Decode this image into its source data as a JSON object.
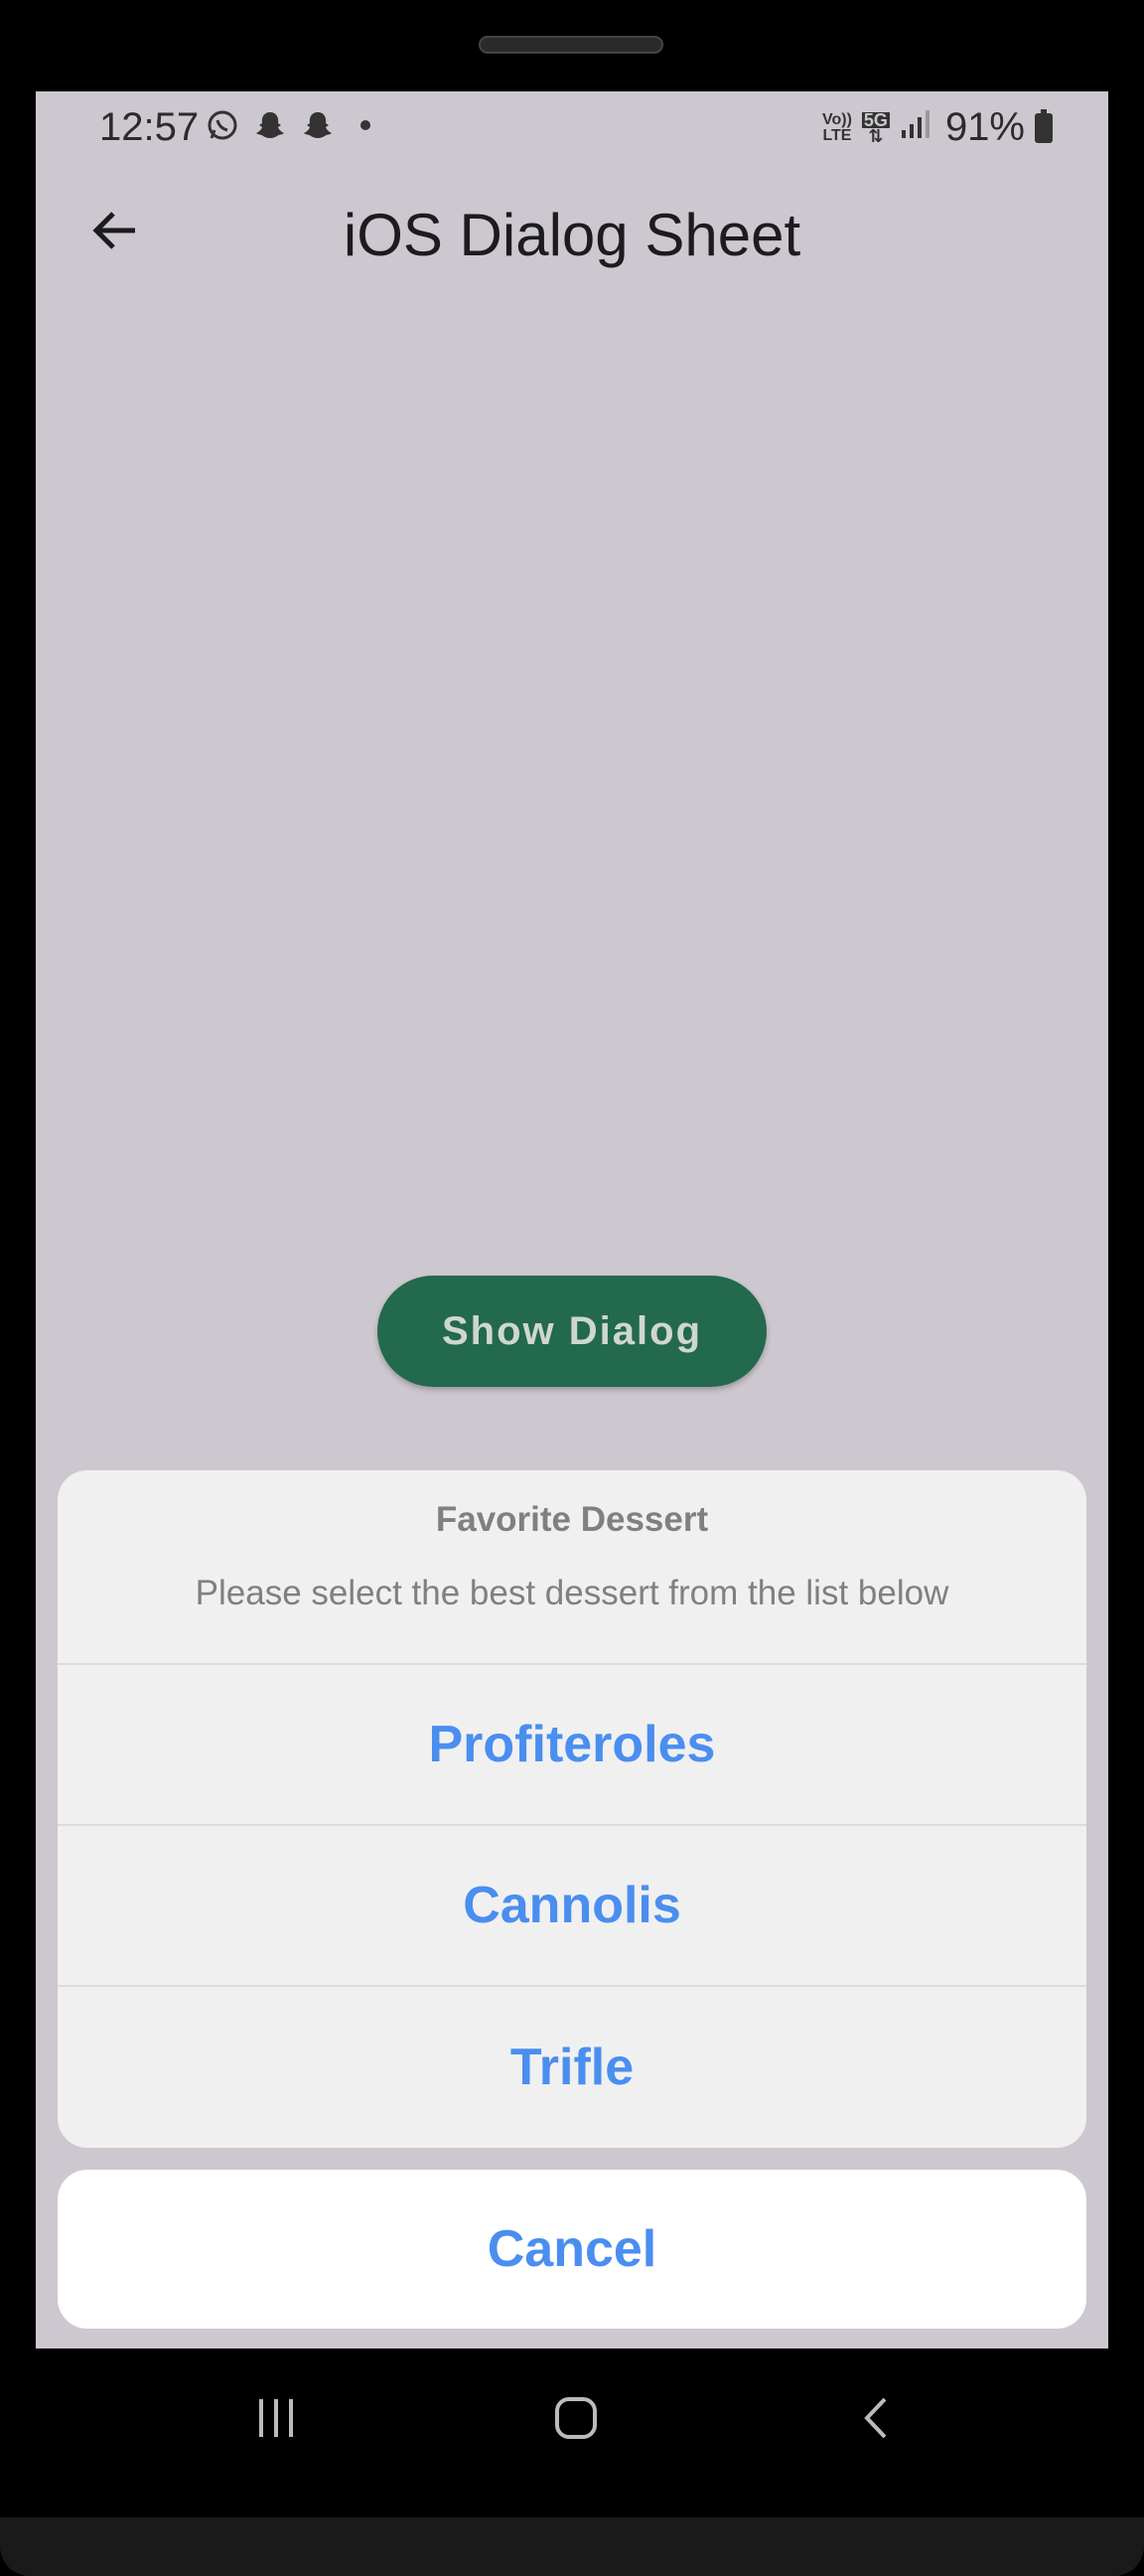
{
  "status_bar": {
    "time": "12:57",
    "left_icons": [
      "whatsapp-icon",
      "snapchat-icon",
      "snapchat-icon",
      "dot-icon"
    ],
    "network_tag_top": "Vo))",
    "network_tag_bottom": "LTE",
    "network_5g": "5G",
    "battery": "91%"
  },
  "app_bar": {
    "title": "iOS Dialog Sheet"
  },
  "main": {
    "show_dialog_label": "Show Dialog",
    "show_dialog_color": "#23694d"
  },
  "action_sheet": {
    "title": "Favorite Dessert",
    "message": "Please select the best dessert from the list below",
    "actions": [
      {
        "label": "Profiteroles"
      },
      {
        "label": "Cannolis"
      },
      {
        "label": "Trifle"
      }
    ],
    "cancel_label": "Cancel",
    "accent_color": "#4a8ef0"
  }
}
